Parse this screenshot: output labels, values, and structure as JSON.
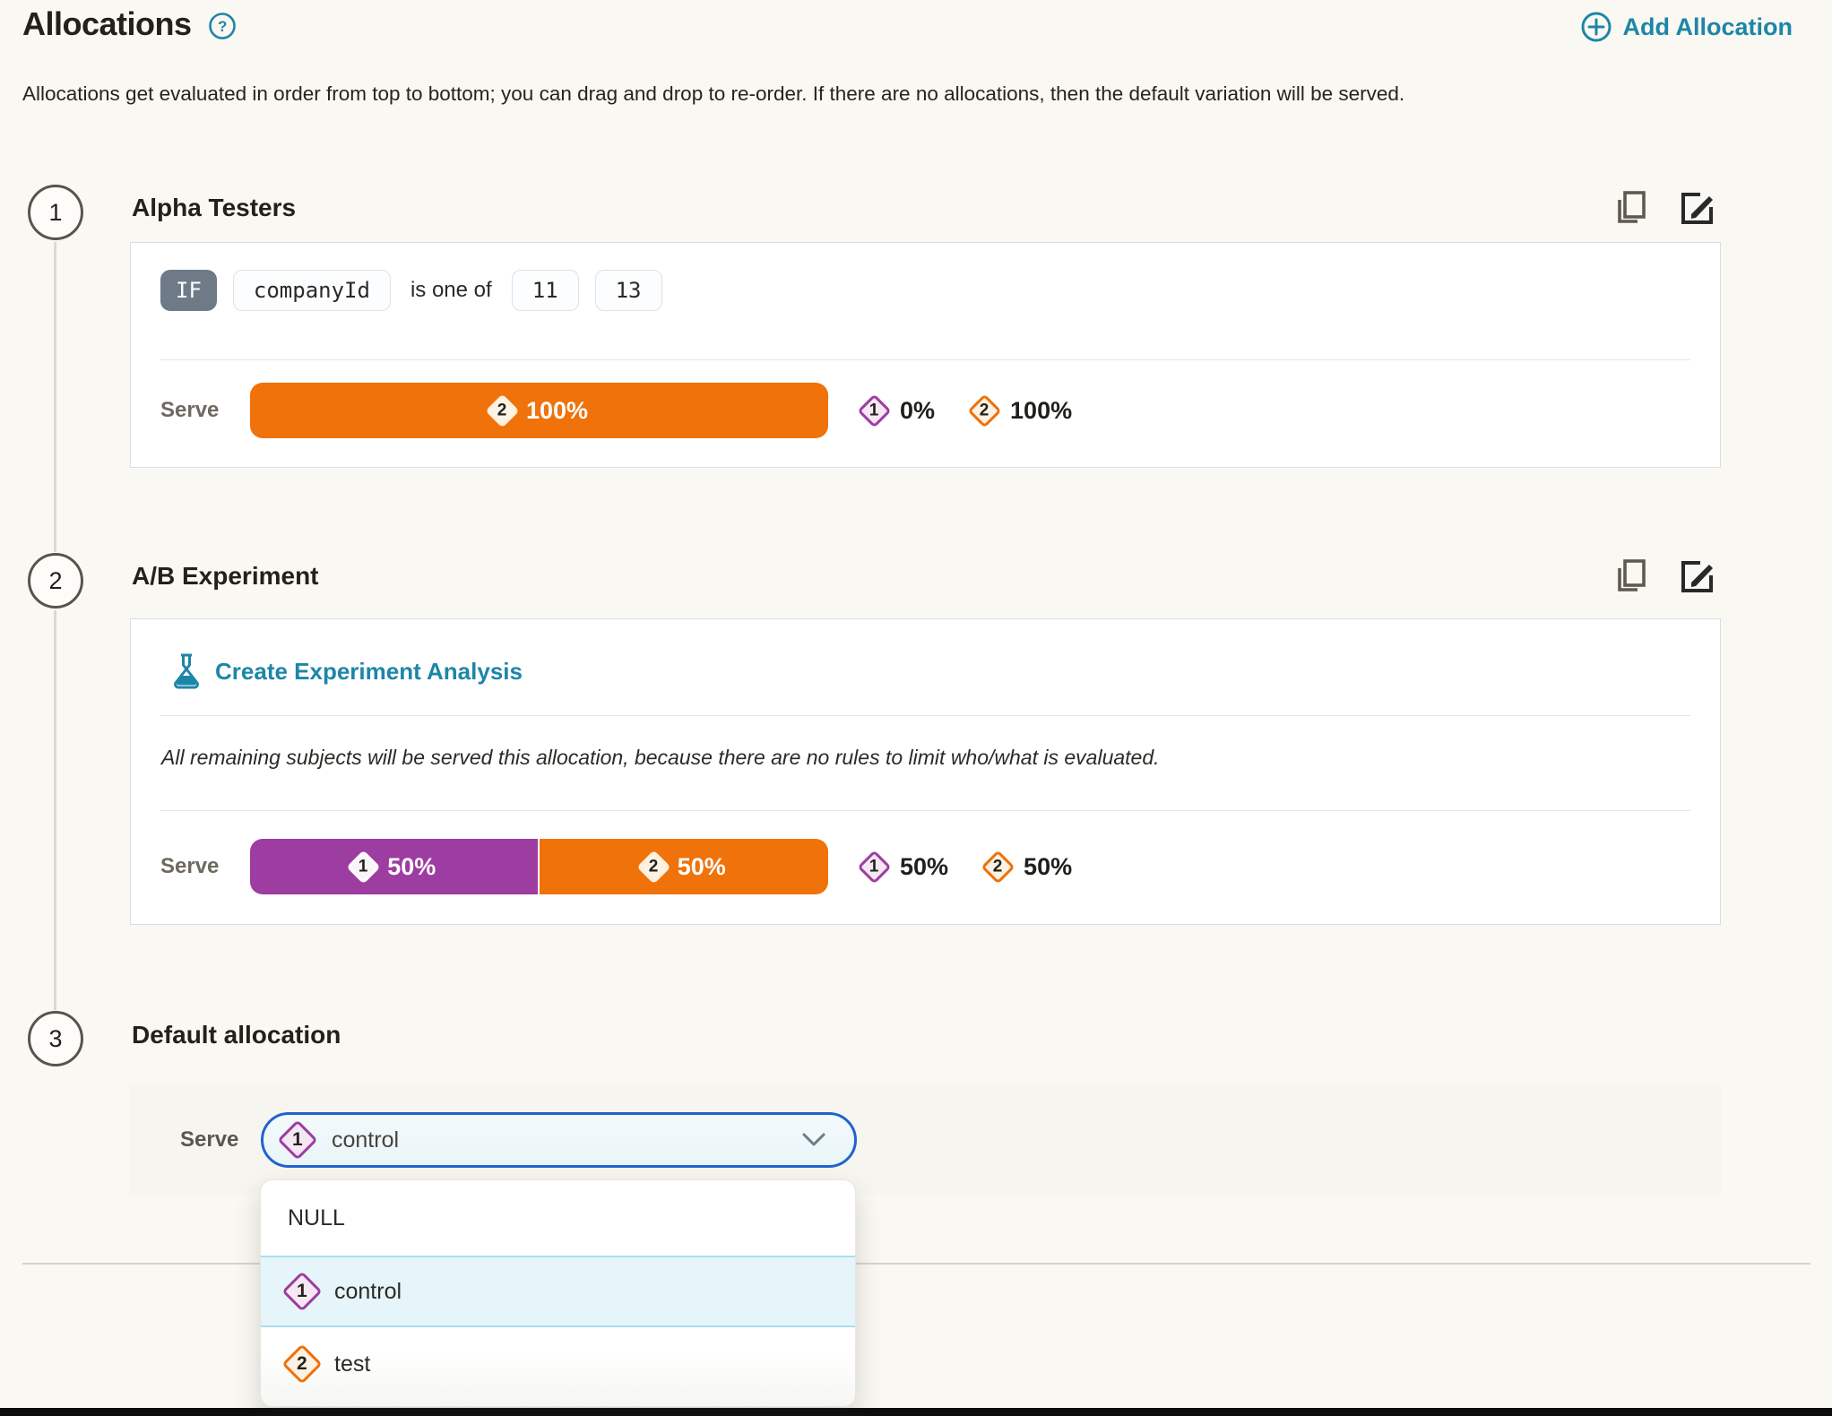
{
  "header": {
    "title": "Allocations",
    "help_icon": "question-mark-circle",
    "add_button_label": "Add Allocation"
  },
  "description": "Allocations get evaluated in order from top to bottom; you can drag and drop to re-order. If there are no allocations, then the default variation will be served.",
  "colors": {
    "accent_teal": "#1d86a8",
    "variation_1_purple": "#9d3da1",
    "variation_2_orange": "#f0720a",
    "select_border_blue": "#2063cf",
    "highlight_cyan": "#e5f5f9"
  },
  "allocations": [
    {
      "step": "1",
      "name": "Alpha Testers",
      "rule": {
        "if_label": "IF",
        "attribute": "companyId",
        "operator": "is one of",
        "values": [
          "11",
          "13"
        ]
      },
      "serve_label": "Serve",
      "bar_segments": [
        {
          "variation_number": "2",
          "percent": "100%"
        }
      ],
      "legend": [
        {
          "variation_number": "1",
          "percent": "0%"
        },
        {
          "variation_number": "2",
          "percent": "100%"
        }
      ]
    },
    {
      "step": "2",
      "name": "A/B Experiment",
      "analysis_link_label": "Create Experiment Analysis",
      "note": "All remaining subjects will be served this allocation, because there are no rules to limit who/what is evaluated.",
      "serve_label": "Serve",
      "bar_segments": [
        {
          "variation_number": "1",
          "percent": "50%"
        },
        {
          "variation_number": "2",
          "percent": "50%"
        }
      ],
      "legend": [
        {
          "variation_number": "1",
          "percent": "50%"
        },
        {
          "variation_number": "2",
          "percent": "50%"
        }
      ]
    },
    {
      "step": "3",
      "name": "Default allocation",
      "serve_label": "Serve",
      "select": {
        "variation_number": "1",
        "value": "control"
      },
      "dropdown_options": [
        {
          "label": "NULL"
        },
        {
          "variation_number": "1",
          "label": "control",
          "highlighted": true
        },
        {
          "variation_number": "2",
          "label": "test"
        }
      ]
    }
  ]
}
